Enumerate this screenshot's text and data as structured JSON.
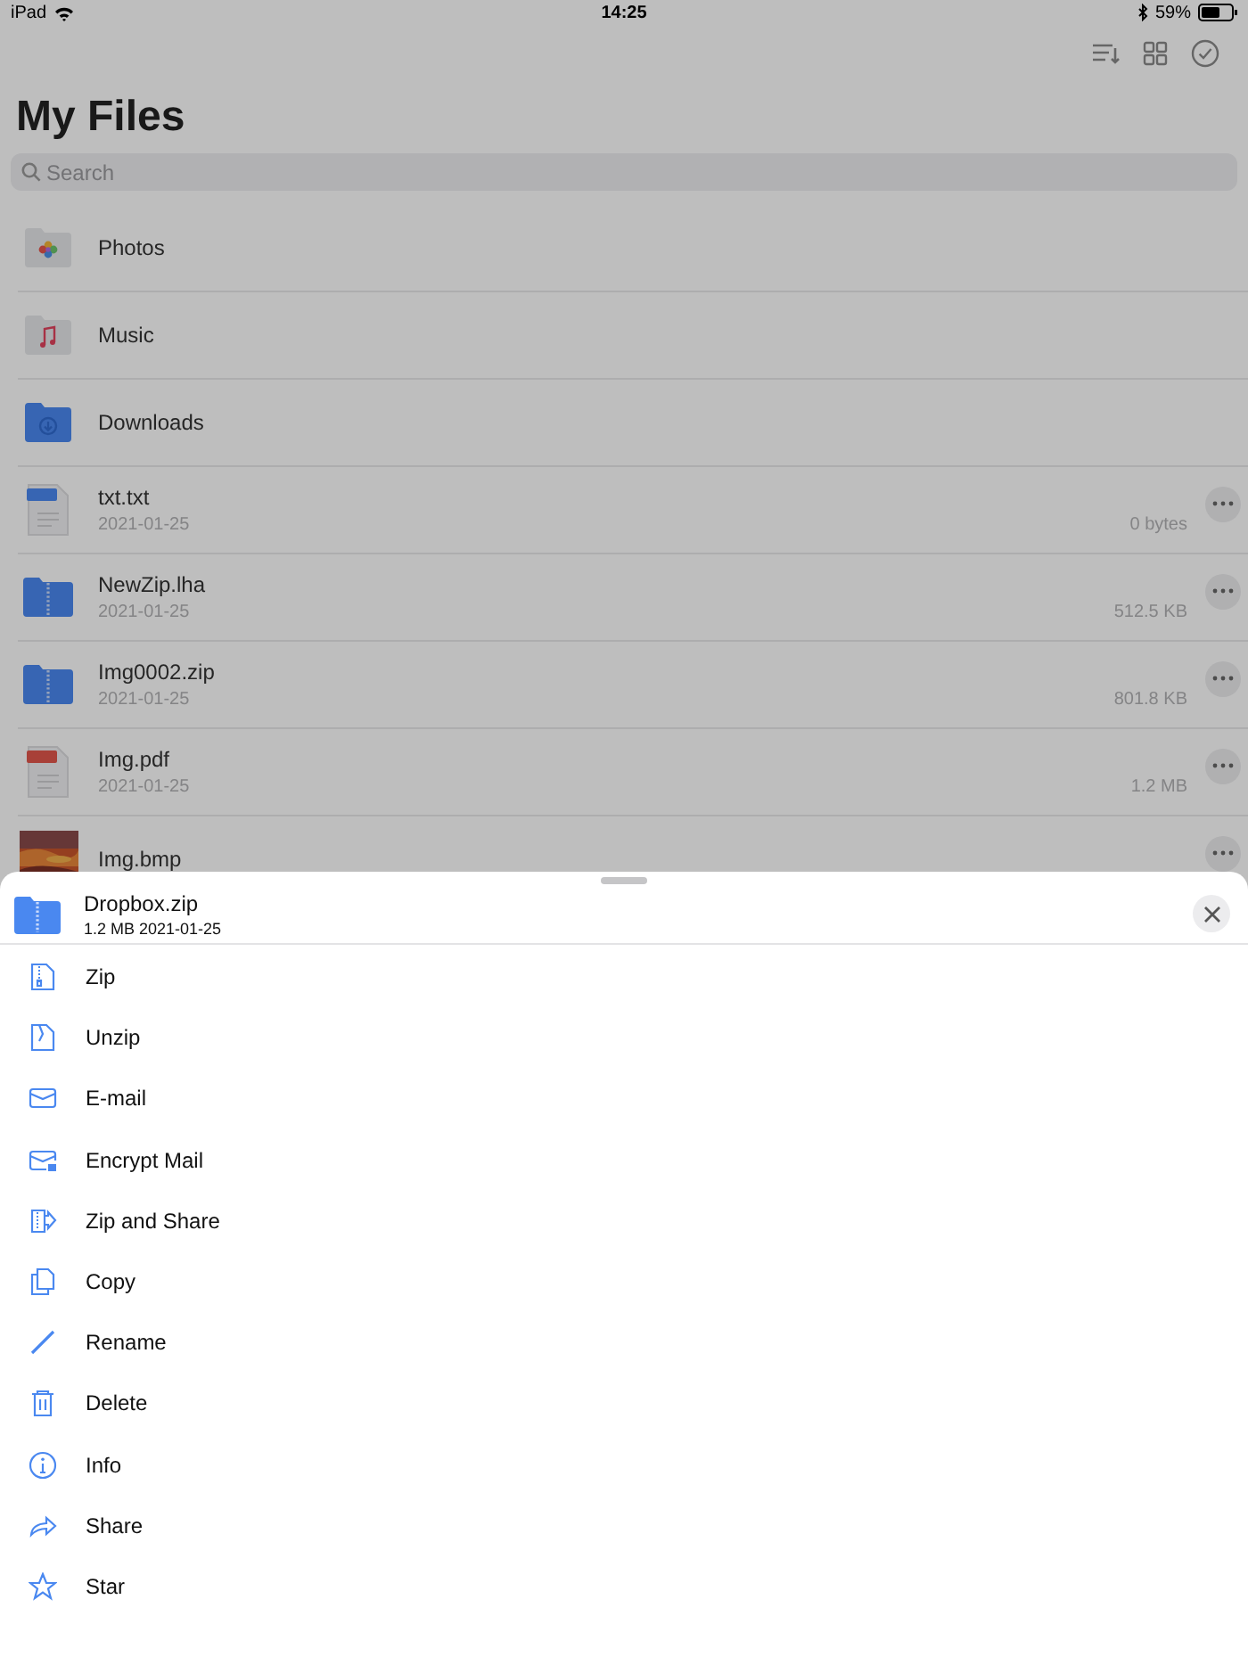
{
  "status_bar": {
    "device": "iPad",
    "time": "14:25",
    "battery": "59%"
  },
  "title": "My Files",
  "search": {
    "placeholder": "Search"
  },
  "files": [
    {
      "kind": "photos-folder",
      "name": "Photos"
    },
    {
      "kind": "music-folder",
      "name": "Music"
    },
    {
      "kind": "downloads-folder",
      "name": "Downloads"
    },
    {
      "kind": "text",
      "name": "txt.txt",
      "date": "2021-01-25",
      "size": "0 bytes"
    },
    {
      "kind": "archive",
      "name": "NewZip.lha",
      "date": "2021-01-25",
      "size": "512.5 KB"
    },
    {
      "kind": "archive",
      "name": "Img0002.zip",
      "date": "2021-01-25",
      "size": "801.8 KB"
    },
    {
      "kind": "pdf",
      "name": "Img.pdf",
      "date": "2021-01-25",
      "size": "1.2 MB"
    },
    {
      "name": "Img.bmp"
    }
  ],
  "sheet": {
    "file_name": "Dropbox.zip",
    "details": "1.2 MB 2021-01-25",
    "actions": [
      {
        "kind": "zip",
        "label": "Zip"
      },
      {
        "kind": "unzip",
        "label": "Unzip"
      },
      {
        "kind": "email",
        "label": "E-mail"
      },
      {
        "kind": "encrypt-mail",
        "label": "Encrypt Mail"
      },
      {
        "kind": "zip-share",
        "label": "Zip and Share"
      },
      {
        "kind": "copy",
        "label": "Copy"
      },
      {
        "kind": "rename",
        "label": "Rename"
      },
      {
        "kind": "delete",
        "label": "Delete"
      },
      {
        "kind": "info",
        "label": "Info"
      },
      {
        "kind": "share",
        "label": "Share"
      },
      {
        "kind": "star",
        "label": "Star"
      }
    ]
  }
}
